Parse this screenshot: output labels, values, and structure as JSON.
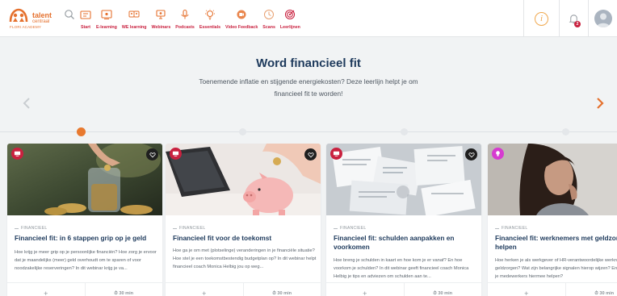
{
  "brand": {
    "name": "talent",
    "name2": "centraal",
    "tagline": "FLORI ACADEMY"
  },
  "nav": [
    {
      "label": "",
      "icon": "search-icon"
    },
    {
      "label": "Start",
      "icon": "home-icon"
    },
    {
      "label": "E-learning",
      "icon": "e-learning-icon"
    },
    {
      "label": "WE learning",
      "icon": "we-learning-icon"
    },
    {
      "label": "Webinars",
      "icon": "webinar-icon"
    },
    {
      "label": "Podcasts",
      "icon": "podcast-icon"
    },
    {
      "label": "Essentials",
      "icon": "essentials-icon"
    },
    {
      "label": "Video Feedback",
      "icon": "video-feedback-icon"
    },
    {
      "label": "Scans",
      "icon": "scans-icon"
    },
    {
      "label": "Leerlijnen",
      "icon": "target-icon"
    }
  ],
  "header": {
    "notification_count": "2",
    "info_label": "i"
  },
  "hero": {
    "title": "Word financieel fit",
    "description": "Toenemende inflatie en stijgende energiekosten? Deze leerlijn helpt je om financieel fit te worden!"
  },
  "timeline": {
    "steps": 5,
    "active_step": 1
  },
  "cards": [
    {
      "type": "webinar",
      "type_icon": "webinar-icon",
      "type_color": "#c9213f",
      "category": "FINANCIEEL",
      "title": "Financieel fit: in 6 stappen grip op je geld",
      "description": "Hoe krijg je meer grip op je persoonlijke financiën? Hoe zorg je ervoor dat je maandelijks (meer) geld overhoudt om te sparen of voor noodzakelijke reserveringen? In dit webinar krijg je va...",
      "add_label": "+",
      "duration": "30 min"
    },
    {
      "type": "webinar",
      "type_icon": "webinar-icon",
      "type_color": "#c9213f",
      "category": "FINANCIEEL",
      "title": "Financieel fit voor de toekomst",
      "description": "Hoe ga je om met (plotselinge) veranderingen in je financiële situatie? Hoe stel je een toekomstbestendig budgetplan op? In dit webinar helpt financieel coach Monica Helbig jou op weg...",
      "add_label": "+",
      "duration": "30 min"
    },
    {
      "type": "webinar",
      "type_icon": "webinar-icon",
      "type_color": "#c9213f",
      "category": "FINANCIEEL",
      "title": "Financieel fit: schulden aanpakken en voorkomen",
      "description": "Hoe breng je schulden in kaart en hoe kom je er vanaf? En hoe voorkom je schulden? In dit webinar geeft financieel coach Monica Helbig je tips en adviezen om schulden aan te...",
      "add_label": "+",
      "duration": "30 min"
    },
    {
      "type": "essential",
      "type_icon": "bulb-icon",
      "type_color": "#d63bd0",
      "category": "FINANCIEEL",
      "title": "Financieel fit: werknemers met geldzorgen helpen",
      "description": "Hoe herken je als werkgever of HR-verantwoordelijke werknemers met geldzorgen? Wat zijn belangrijke signalen hierop wijzen? En hoe kun je medewerkers hiermee helpen?",
      "add_label": "+",
      "duration": "30 min"
    }
  ]
}
